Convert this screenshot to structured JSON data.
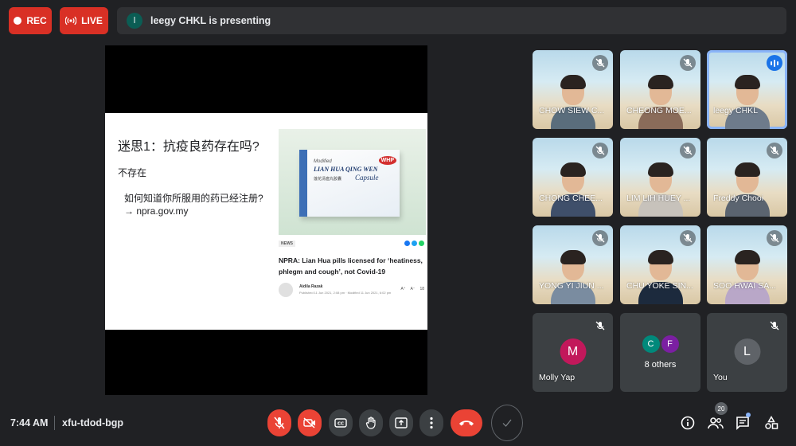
{
  "top_bar": {
    "rec_label": "REC",
    "live_label": "LIVE",
    "presenter_initial": "l",
    "presenting_text": "leegy CHKL is presenting"
  },
  "slide": {
    "title": "迷思1：抗疫良药存在吗?",
    "line1": "不存在",
    "line2": "如何知道你所服用的药已经注册?",
    "line3": "→ npra.gov.my",
    "article": {
      "box_modified": "Modified",
      "box_brand": "LIAN HUA QING WEN",
      "box_cn": "莲花清瘟丸胶囊",
      "box_capsule": "Capsule",
      "box_badge": "WHP",
      "news_tag": "NEWS",
      "headline": "NPRA: Lian Hua pills licensed for ‘heatiness, phlegm and cough’, not Covid-19",
      "author_name": "Aidila Razak",
      "author_meta": "Published 11 Jun 2021, 2:08 pm · Modified 11 Jun 2021, 6:02 pm",
      "font_larger": "A⁺",
      "font_smaller": "A⁻",
      "comments": "18"
    }
  },
  "participants": [
    {
      "name": "CHOW SIEW C..."
    },
    {
      "name": "CHEONG MOE..."
    },
    {
      "name": "leegy CHKL"
    },
    {
      "name": "CHONG CHEE..."
    },
    {
      "name": "LIM LIH HUEY ..."
    },
    {
      "name": "Freddy Chooi"
    },
    {
      "name": "YONG YI JIUN ..."
    },
    {
      "name": "CHU YOKE SIN..."
    },
    {
      "name": "SOO HWAI SA..."
    }
  ],
  "molly": {
    "initial": "M",
    "name": "Molly Yap"
  },
  "others": {
    "initial_1": "C",
    "initial_2": "F",
    "label": "8 others"
  },
  "you": {
    "initial": "L",
    "name": "You"
  },
  "bottom_bar": {
    "time": "7:44 AM",
    "meeting_code": "xfu-tdod-bgp",
    "people_count": "20"
  },
  "colors": {
    "background": "#202124",
    "danger": "#ea4335",
    "rec": "#d93025",
    "accent": "#8ab4f8",
    "molly_avatar": "#c2185b",
    "you_avatar": "#5f6368",
    "others_c": "#00897b",
    "others_f": "#7b1fa2"
  }
}
